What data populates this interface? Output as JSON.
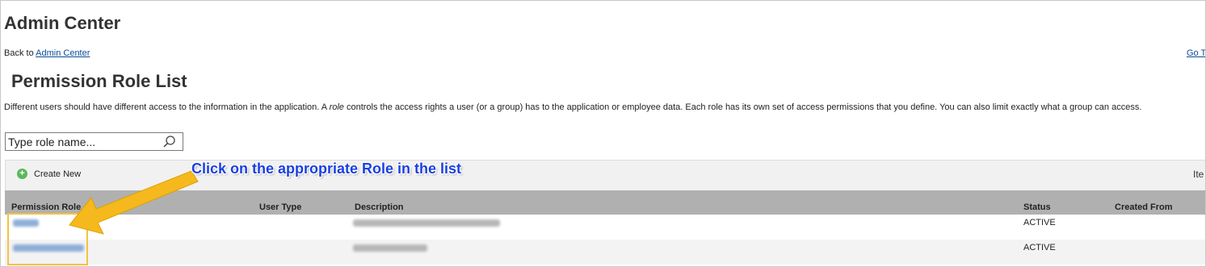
{
  "header": {
    "title": "Admin Center",
    "back_prefix": "Back to ",
    "back_link": "Admin Center",
    "goto_link": "Go T"
  },
  "page": {
    "title": "Permission Role List",
    "description_part1": "Different users should have different access to the information in the application. A ",
    "description_italic": "role",
    "description_part2": " controls the access rights a user (or a group) has to the application or employee data. Each role has its own set of access permissions that you define. You can also limit exactly what a group can access."
  },
  "search": {
    "placeholder": "Type role name...",
    "icon": "search-icon"
  },
  "toolbar": {
    "create_label": "Create New",
    "create_icon": "plus-circle-icon",
    "items_label": "Ite"
  },
  "table": {
    "columns": [
      "Permission Role",
      "User Type",
      "Description",
      "Status",
      "Created From"
    ],
    "rows": [
      {
        "status": "ACTIVE"
      },
      {
        "status": "ACTIVE"
      }
    ]
  },
  "annotation": {
    "callout": "Click on the appropriate Role in the list",
    "accent": "#f5c242",
    "callout_color": "#1a3fe0"
  }
}
